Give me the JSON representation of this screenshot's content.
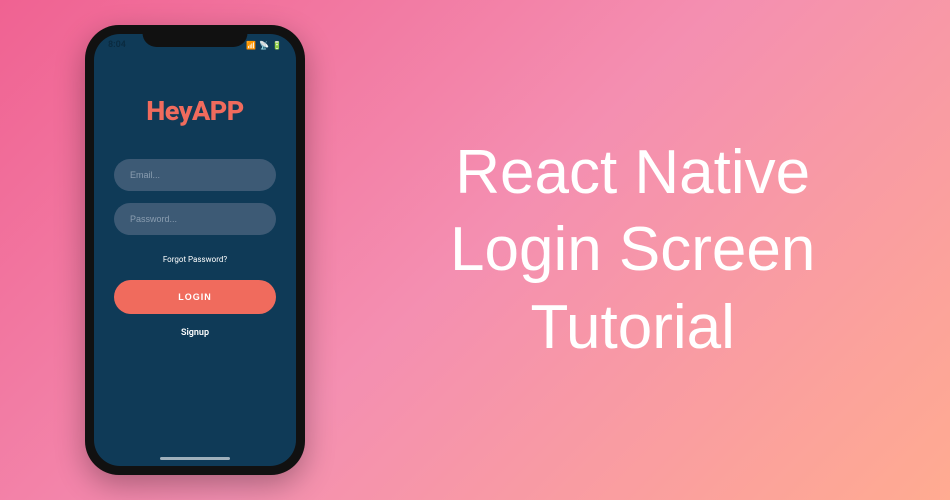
{
  "title": {
    "line1": "React Native",
    "line2": "Login Screen",
    "line3": "Tutorial"
  },
  "phone": {
    "status_bar": {
      "time": "8:04"
    },
    "app": {
      "logo": "HeyAPP",
      "email_placeholder": "Email...",
      "password_placeholder": "Password...",
      "forgot_link": "Forgot Password?",
      "login_button": "LOGIN",
      "signup_link": "Signup"
    }
  }
}
